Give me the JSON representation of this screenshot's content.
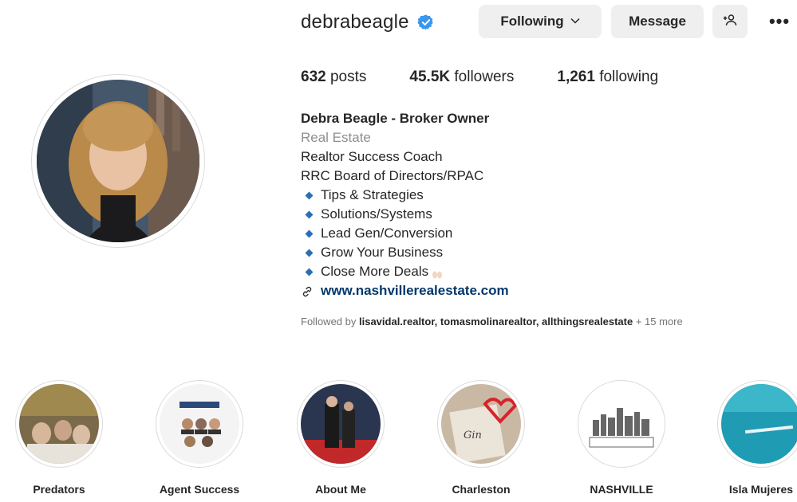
{
  "profile": {
    "username": "debrabeagle",
    "verified_icon": "verified-badge-icon",
    "buttons": {
      "following": "Following",
      "message": "Message",
      "suggest_icon": "add-person-icon",
      "more": "•••"
    },
    "stats": {
      "posts_count": "632",
      "posts_label": "posts",
      "followers_count": "45.5K",
      "followers_label": "followers",
      "following_count": "1,261",
      "following_label": "following"
    },
    "bio": {
      "name": "Debra Beagle - Broker Owner",
      "category": "Real Estate",
      "lines": [
        "Realtor Success Coach",
        "RRC Board of Directors/RPAC"
      ],
      "bullets": [
        "Tips & Strategies",
        "Solutions/Systems",
        "Lead Gen/Conversion",
        "Grow Your Business",
        "Close More Deals"
      ],
      "link": "www.nashvillerealestate.com"
    },
    "followed_by": {
      "prefix": "Followed by",
      "users": "lisavidal.realtor, tomasmolinarealtor, allthingsrealestate",
      "more": "+ 15 more"
    }
  },
  "highlights": [
    {
      "label": "Predators"
    },
    {
      "label": "Agent Success"
    },
    {
      "label": "About Me"
    },
    {
      "label": "Charleston"
    },
    {
      "label": "NASHVILLE"
    },
    {
      "label": "Isla Mujeres"
    }
  ],
  "colors": {
    "verified": "#3897f0",
    "link": "#00376b",
    "button_bg": "#efefef",
    "muted": "#8e8e8e",
    "bullet": "#2a6fb5"
  }
}
